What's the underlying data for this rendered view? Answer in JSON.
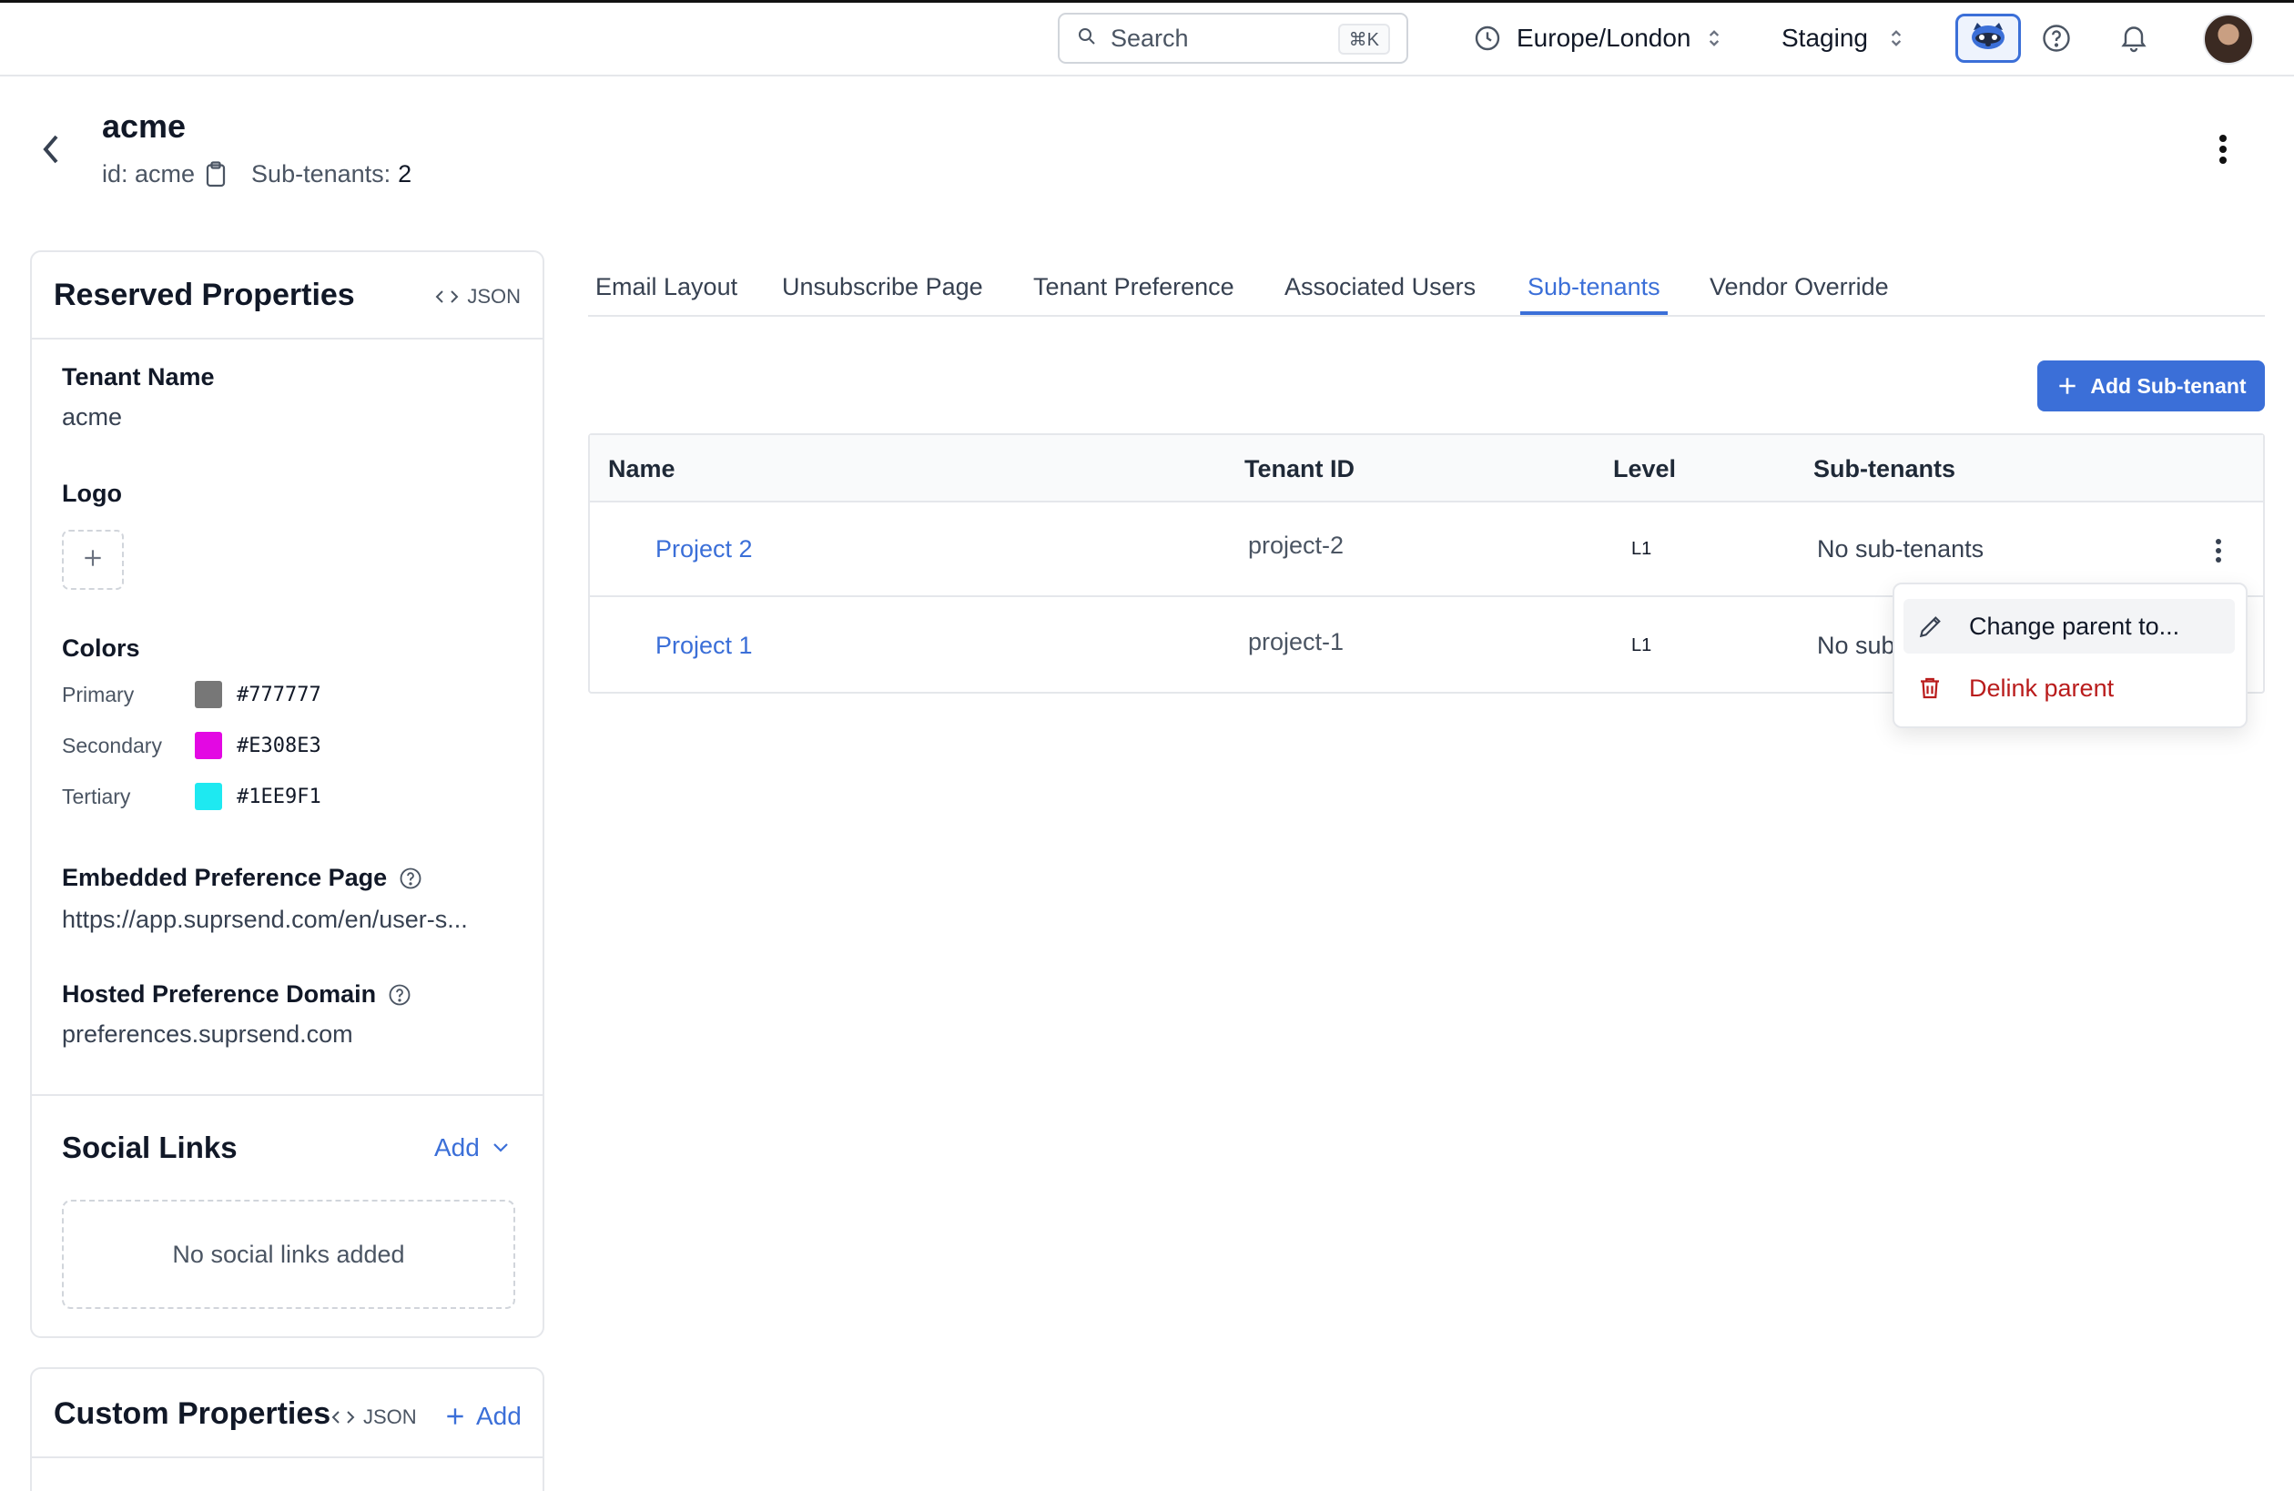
{
  "topbar": {
    "search_label": "Search",
    "search_shortcut": "⌘K",
    "timezone": "Europe/London",
    "environment": "Staging"
  },
  "header": {
    "title": "acme",
    "id_label": "id: acme",
    "subtenants_label": "Sub-tenants:",
    "subtenants_count": "2"
  },
  "reserved": {
    "title": "Reserved Properties",
    "json_label": "JSON",
    "tenant_name_label": "Tenant Name",
    "tenant_name_value": "acme",
    "logo_label": "Logo",
    "colors_label": "Colors",
    "colors": [
      {
        "name": "Primary",
        "hex": "#777777"
      },
      {
        "name": "Secondary",
        "hex": "#E308E3"
      },
      {
        "name": "Tertiary",
        "hex": "#1EE9F1"
      }
    ],
    "embedded_label": "Embedded Preference Page",
    "embedded_value": "https://app.suprsend.com/en/user-s...",
    "hosted_label": "Hosted Preference Domain",
    "hosted_value": "preferences.suprsend.com",
    "social_title": "Social Links",
    "social_add": "Add",
    "social_empty": "No social links added"
  },
  "custom": {
    "title": "Custom Properties",
    "json_label": "JSON",
    "add_label": "Add"
  },
  "tabs": [
    {
      "label": "Email Layout"
    },
    {
      "label": "Unsubscribe Page"
    },
    {
      "label": "Tenant Preference"
    },
    {
      "label": "Associated Users"
    },
    {
      "label": "Sub-tenants",
      "active": true
    },
    {
      "label": "Vendor Override"
    }
  ],
  "add_subtenant_label": "Add Sub-tenant",
  "table": {
    "columns": [
      "Name",
      "Tenant ID",
      "Level",
      "Sub-tenants"
    ],
    "rows": [
      {
        "name": "Project 2",
        "tenant_id": "project-2",
        "level": "L1",
        "subtenants": "No sub-tenants"
      },
      {
        "name": "Project 1",
        "tenant_id": "project-1",
        "level": "L1",
        "subtenants": "No sub"
      }
    ]
  },
  "menu": {
    "change_parent": "Change parent to...",
    "delink_parent": "Delink parent"
  }
}
